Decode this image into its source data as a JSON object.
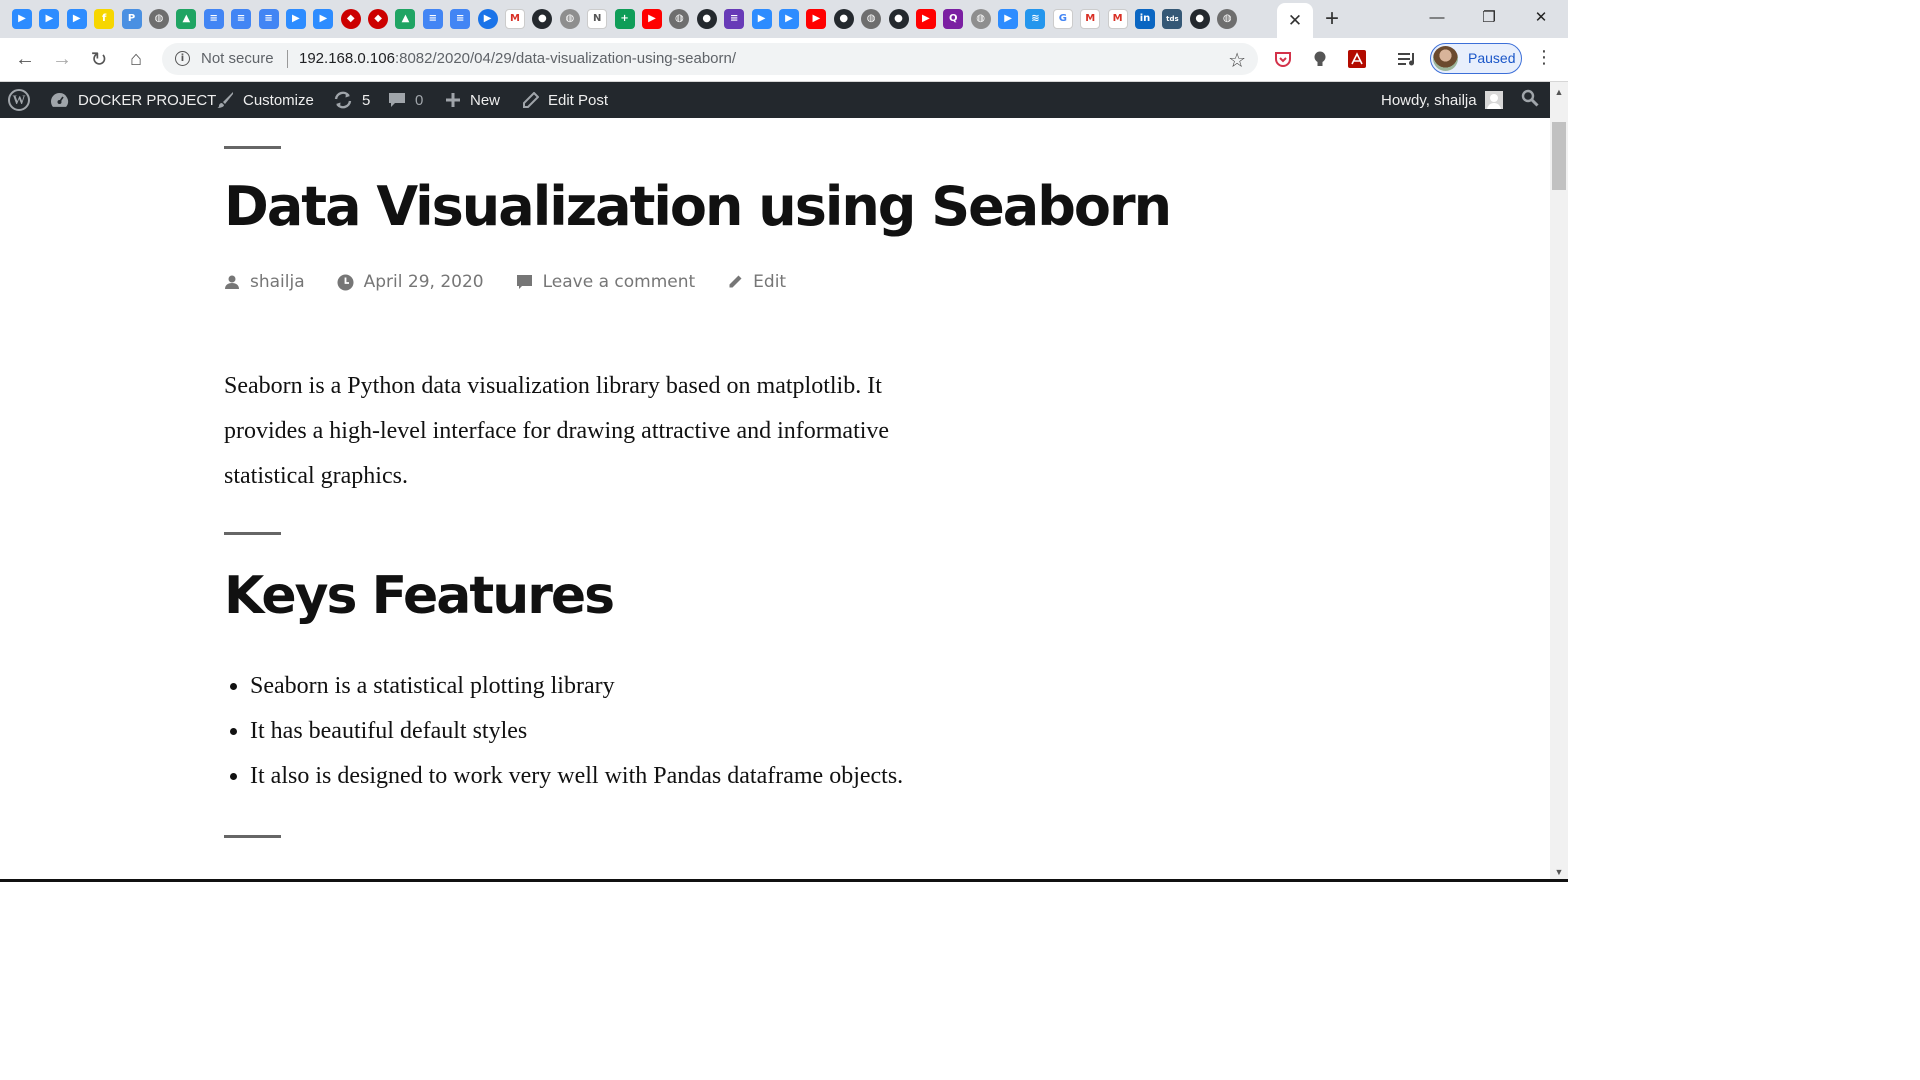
{
  "browser": {
    "favicons": [
      {
        "icon": "zoom-icon",
        "bg": "#2d8cff",
        "glyph": "▶"
      },
      {
        "icon": "zoom-icon",
        "bg": "#2d8cff",
        "glyph": "▶"
      },
      {
        "icon": "zoom-icon",
        "bg": "#2d8cff",
        "glyph": "▶"
      },
      {
        "icon": "flipkart-icon",
        "bg": "#f6d600",
        "glyph": "f"
      },
      {
        "icon": "app-icon",
        "bg": "#4a90e2",
        "glyph": "P"
      },
      {
        "icon": "globe-icon",
        "bg": "#6e6e6e",
        "glyph": "◍",
        "round": true
      },
      {
        "icon": "google-drive-icon",
        "bg": "#1fa463",
        "glyph": "▲"
      },
      {
        "icon": "google-docs-icon",
        "bg": "#4285f4",
        "glyph": "≡"
      },
      {
        "icon": "google-docs-icon",
        "bg": "#4285f4",
        "glyph": "≡"
      },
      {
        "icon": "google-docs-icon",
        "bg": "#4285f4",
        "glyph": "≡"
      },
      {
        "icon": "zoom-icon",
        "bg": "#2d8cff",
        "glyph": "▶"
      },
      {
        "icon": "zoom-icon",
        "bg": "#2d8cff",
        "glyph": "▶"
      },
      {
        "icon": "redhat-icon",
        "bg": "#cc0000",
        "glyph": "◆",
        "round": true
      },
      {
        "icon": "redhat-icon",
        "bg": "#cc0000",
        "glyph": "◆",
        "round": true
      },
      {
        "icon": "google-drive-icon",
        "bg": "#1fa463",
        "glyph": "▲"
      },
      {
        "icon": "google-docs-icon",
        "bg": "#4285f4",
        "glyph": "≡"
      },
      {
        "icon": "google-docs-icon",
        "bg": "#4285f4",
        "glyph": "≡"
      },
      {
        "icon": "meet-icon",
        "bg": "#1a73e8",
        "glyph": "▶",
        "round": true
      },
      {
        "icon": "gmail-icon",
        "bg": "#ffffff",
        "glyph": "M",
        "fg": "#d93025"
      },
      {
        "icon": "github-icon",
        "bg": "#24292e",
        "glyph": "●",
        "round": true
      },
      {
        "icon": "globe-icon",
        "bg": "#8e8e8e",
        "glyph": "◍",
        "round": true
      },
      {
        "icon": "notion-icon",
        "bg": "#ffffff",
        "glyph": "N",
        "fg": "#555"
      },
      {
        "icon": "google-sheets-icon",
        "bg": "#0f9d58",
        "glyph": "+"
      },
      {
        "icon": "youtube-icon",
        "bg": "#ff0000",
        "glyph": "▶"
      },
      {
        "icon": "globe-icon",
        "bg": "#6e6e6e",
        "glyph": "◍",
        "round": true
      },
      {
        "icon": "github-icon",
        "bg": "#24292e",
        "glyph": "●",
        "round": true
      },
      {
        "icon": "forms-icon",
        "bg": "#673ab7",
        "glyph": "≡"
      },
      {
        "icon": "zoom-icon",
        "bg": "#2d8cff",
        "glyph": "▶"
      },
      {
        "icon": "zoom-icon",
        "bg": "#2d8cff",
        "glyph": "▶"
      },
      {
        "icon": "youtube-icon",
        "bg": "#ff0000",
        "glyph": "▶"
      },
      {
        "icon": "github-icon",
        "bg": "#24292e",
        "glyph": "●",
        "round": true
      },
      {
        "icon": "globe-icon",
        "bg": "#6e6e6e",
        "glyph": "◍",
        "round": true
      },
      {
        "icon": "github-icon",
        "bg": "#24292e",
        "glyph": "●",
        "round": true
      },
      {
        "icon": "youtube-icon",
        "bg": "#ff0000",
        "glyph": "▶"
      },
      {
        "icon": "app-icon",
        "bg": "#7b1fa2",
        "glyph": "Q"
      },
      {
        "icon": "globe-icon",
        "bg": "#8e8e8e",
        "glyph": "◍",
        "round": true
      },
      {
        "icon": "zoom-icon",
        "bg": "#2d8cff",
        "glyph": "▶"
      },
      {
        "icon": "docker-icon",
        "bg": "#2496ed",
        "glyph": "≋"
      },
      {
        "icon": "google-icon",
        "bg": "#ffffff",
        "glyph": "G",
        "fg": "#4285f4"
      },
      {
        "icon": "gmail-icon",
        "bg": "#ffffff",
        "glyph": "M",
        "fg": "#d93025"
      },
      {
        "icon": "gmail-icon",
        "bg": "#ffffff",
        "glyph": "M",
        "fg": "#d93025"
      },
      {
        "icon": "linkedin-icon",
        "bg": "#0a66c2",
        "glyph": "in"
      },
      {
        "icon": "tds-icon",
        "bg": "#355876",
        "glyph": "tds"
      },
      {
        "icon": "github-icon",
        "bg": "#24292e",
        "glyph": "●",
        "round": true
      },
      {
        "icon": "globe-icon",
        "bg": "#6e6e6e",
        "glyph": "◍",
        "round": true
      }
    ],
    "close_glyph": "✕",
    "new_tab_glyph": "+",
    "window_controls": {
      "minimize": "—",
      "restore": "❐",
      "close": "✕"
    },
    "toolbar": {
      "back_glyph": "←",
      "forward_glyph": "→",
      "reload_glyph": "↻",
      "home_glyph": "⌂",
      "security_label": "Not secure",
      "url_host": "192.168.0.106",
      "url_path": ":8082/2020/04/29/data-visualization-using-seaborn/",
      "star_glyph": "☆",
      "profile_status": "Paused",
      "menu_glyph": "⋮"
    }
  },
  "admin_bar": {
    "site_name": "DOCKER PROJECT",
    "customize": "Customize",
    "updates_count": "5",
    "comments_count": "0",
    "new_label": "New",
    "edit_post": "Edit Post",
    "howdy": "Howdy, shailja"
  },
  "post": {
    "title": "Data Visualization using Seaborn",
    "author": "shailja",
    "date": "April 29, 2020",
    "comments": "Leave a comment",
    "edit": "Edit",
    "intro": "Seaborn is a Python data visualization library based on matplotlib. It provides a high-level interface for drawing attractive and informative statistical graphics.",
    "section_heading": "Keys Features",
    "features": [
      "Seaborn is a statistical plotting library",
      "It has beautiful default styles",
      "It also is designed to work very well with Pandas dataframe objects."
    ]
  }
}
